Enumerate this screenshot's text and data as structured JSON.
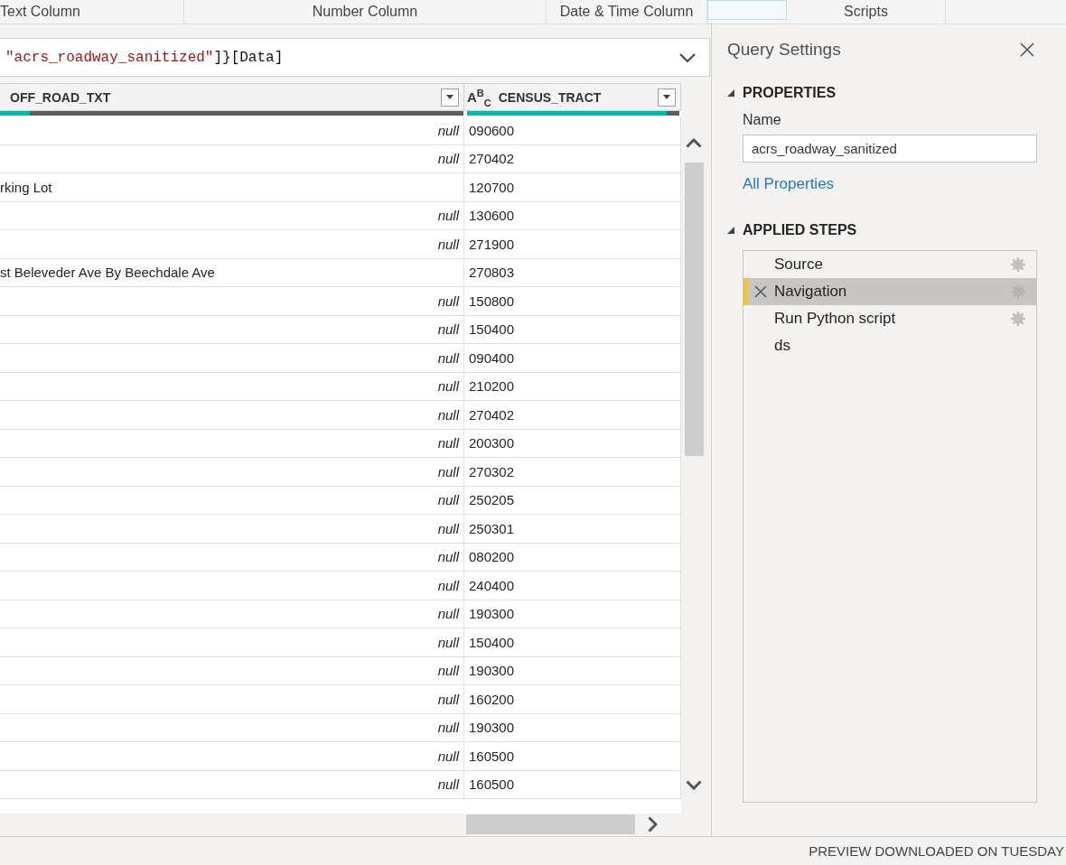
{
  "ribbon": {
    "items": [
      {
        "kind": "group",
        "label": "Text Column"
      },
      {
        "kind": "group",
        "label": "Number Column"
      },
      {
        "kind": "group",
        "label": "Date & Time Column"
      },
      {
        "kind": "button",
        "highlighted": true
      },
      {
        "kind": "group",
        "label": "Scripts"
      }
    ]
  },
  "formula_bar": {
    "parts": [
      {
        "kind": "string",
        "text": "\"acrs_roadway_sanitized\""
      },
      {
        "kind": "plain",
        "text": "]}[Data]"
      }
    ]
  },
  "table": {
    "columns": [
      {
        "name": "OFF_ROAD_TXT",
        "level": 0.065
      },
      {
        "type_icon": "A$^{B}$$_{C}$",
        "name": "CENSUS_TRACT",
        "level": 0.94
      }
    ],
    "rows": [
      {
        "cells": [
          {
            "kind": "null",
            "text": "null"
          },
          {
            "kind": "text",
            "text": "090600"
          }
        ]
      },
      {
        "cells": [
          {
            "kind": "null",
            "text": "null"
          },
          {
            "kind": "text",
            "text": "270402"
          }
        ]
      },
      {
        "cells": [
          {
            "kind": "text",
            "text": "rking Lot"
          },
          {
            "kind": "text",
            "text": "120700"
          }
        ]
      },
      {
        "cells": [
          {
            "kind": "null",
            "text": "null"
          },
          {
            "kind": "text",
            "text": "130600"
          }
        ]
      },
      {
        "cells": [
          {
            "kind": "null",
            "text": "null"
          },
          {
            "kind": "text",
            "text": "271900"
          }
        ]
      },
      {
        "cells": [
          {
            "kind": "text",
            "text": "st Beleveder Ave By Beechdale Ave"
          },
          {
            "kind": "text",
            "text": "270803"
          }
        ]
      },
      {
        "cells": [
          {
            "kind": "null",
            "text": "null"
          },
          {
            "kind": "text",
            "text": "150800"
          }
        ]
      },
      {
        "cells": [
          {
            "kind": "null",
            "text": "null"
          },
          {
            "kind": "text",
            "text": "150400"
          }
        ]
      },
      {
        "cells": [
          {
            "kind": "null",
            "text": "null"
          },
          {
            "kind": "text",
            "text": "090400"
          }
        ]
      },
      {
        "cells": [
          {
            "kind": "null",
            "text": "null"
          },
          {
            "kind": "text",
            "text": "210200"
          }
        ]
      },
      {
        "cells": [
          {
            "kind": "null",
            "text": "null"
          },
          {
            "kind": "text",
            "text": "270402"
          }
        ]
      },
      {
        "cells": [
          {
            "kind": "null",
            "text": "null"
          },
          {
            "kind": "text",
            "text": "200300"
          }
        ]
      },
      {
        "cells": [
          {
            "kind": "null",
            "text": "null"
          },
          {
            "kind": "text",
            "text": "270302"
          }
        ]
      },
      {
        "cells": [
          {
            "kind": "null",
            "text": "null"
          },
          {
            "kind": "text",
            "text": "250205"
          }
        ]
      },
      {
        "cells": [
          {
            "kind": "null",
            "text": "null"
          },
          {
            "kind": "text",
            "text": "250301"
          }
        ]
      },
      {
        "cells": [
          {
            "kind": "null",
            "text": "null"
          },
          {
            "kind": "text",
            "text": "080200"
          }
        ]
      },
      {
        "cells": [
          {
            "kind": "null",
            "text": "null"
          },
          {
            "kind": "text",
            "text": "240400"
          }
        ]
      },
      {
        "cells": [
          {
            "kind": "null",
            "text": "null"
          },
          {
            "kind": "text",
            "text": "190300"
          }
        ]
      },
      {
        "cells": [
          {
            "kind": "null",
            "text": "null"
          },
          {
            "kind": "text",
            "text": "150400"
          }
        ]
      },
      {
        "cells": [
          {
            "kind": "null",
            "text": "null"
          },
          {
            "kind": "text",
            "text": "190300"
          }
        ]
      },
      {
        "cells": [
          {
            "kind": "null",
            "text": "null"
          },
          {
            "kind": "text",
            "text": "160200"
          }
        ]
      },
      {
        "cells": [
          {
            "kind": "null",
            "text": "null"
          },
          {
            "kind": "text",
            "text": "190300"
          }
        ]
      },
      {
        "cells": [
          {
            "kind": "null",
            "text": "null"
          },
          {
            "kind": "text",
            "text": "160500"
          }
        ]
      },
      {
        "cells": [
          {
            "kind": "null",
            "text": "null"
          },
          {
            "kind": "text",
            "text": "160500"
          }
        ]
      }
    ]
  },
  "query_settings": {
    "title": "Query Settings",
    "properties": {
      "heading": "PROPERTIES",
      "expanded": true,
      "name_label": "Name",
      "name_value": "acrs_roadway_sanitized",
      "link": "All Properties"
    },
    "applied_steps": {
      "heading": "APPLIED STEPS",
      "expanded": true,
      "steps": [
        {
          "label": "Source",
          "selected": false,
          "has_settings": true
        },
        {
          "label": "Navigation",
          "selected": true,
          "has_settings": true
        },
        {
          "label": "Run Python script",
          "selected": false,
          "has_settings": true
        },
        {
          "label": "ds",
          "selected": false,
          "has_settings": false
        }
      ]
    }
  },
  "status_bar": {
    "text": "PREVIEW DOWNLOADED ON TUESDAY"
  }
}
